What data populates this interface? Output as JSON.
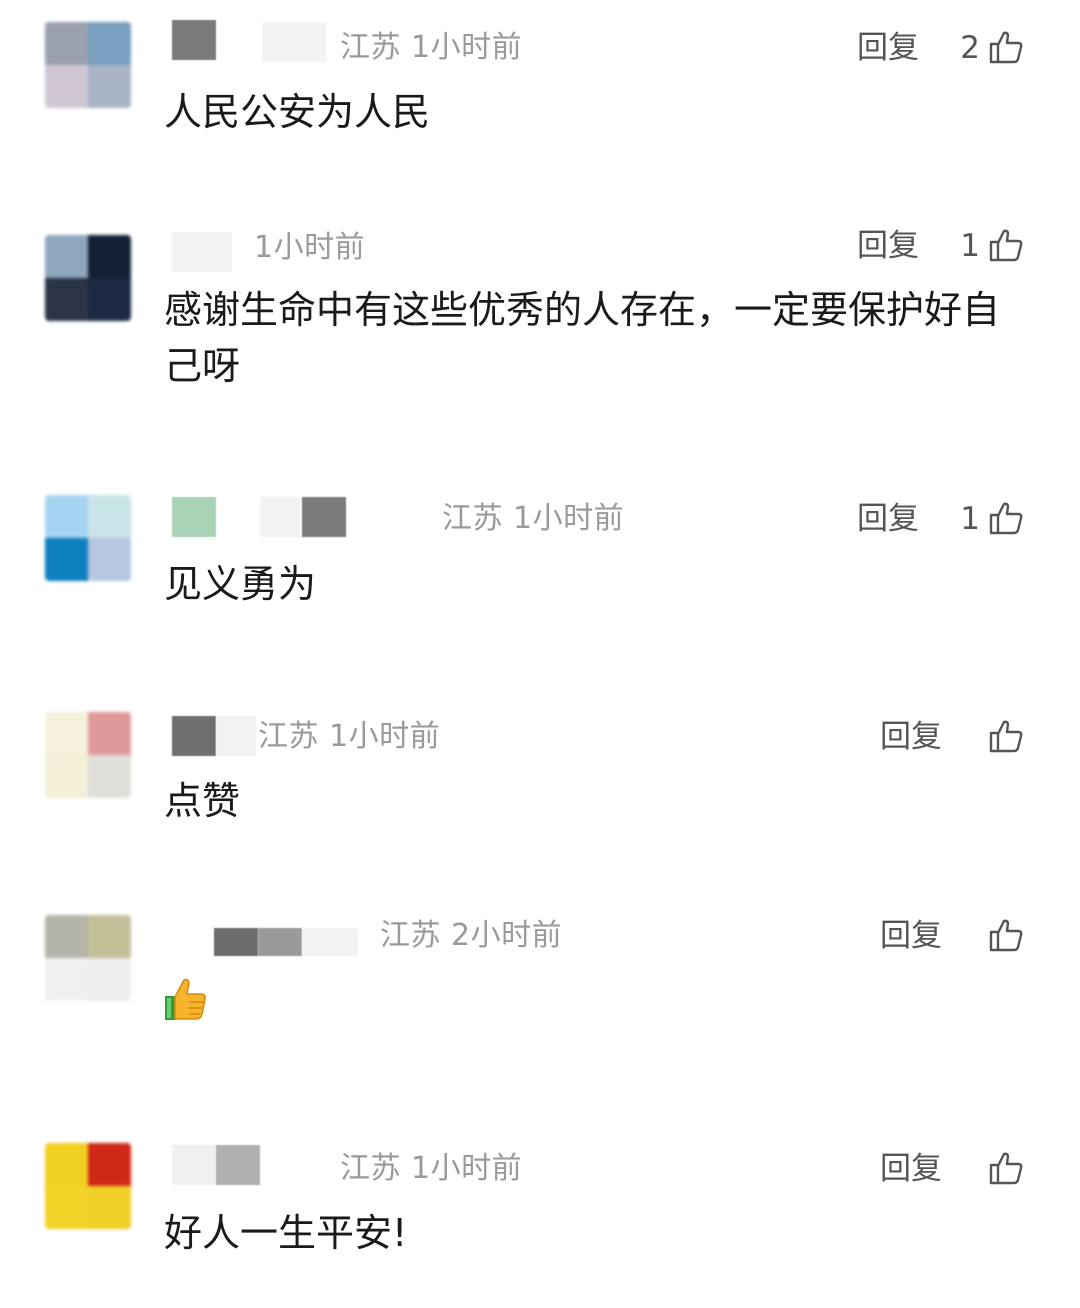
{
  "comments": [
    {
      "location": "江苏",
      "time": "1小时前",
      "reply_label": "回复",
      "likes": "2",
      "text": "人民公安为人民",
      "avatar_colors": [
        "#9aa0b0",
        "#7a9fbf",
        "#cfc6d2",
        "#a9b4c7"
      ]
    },
    {
      "location": "",
      "time": "1小时前",
      "reply_label": "回复",
      "likes": "1",
      "text": "感谢生命中有这些优秀的人存在，一定要保护好自己呀",
      "avatar_colors": [
        "#8ea7bd",
        "#132035",
        "#2a3444",
        "#1c2a44"
      ]
    },
    {
      "location": "江苏",
      "time": "1小时前",
      "reply_label": "回复",
      "likes": "1",
      "text": "见义勇为",
      "avatar_colors": [
        "#a6d4f0",
        "#c9e4e8",
        "#0e7fbf",
        "#b7c7e0"
      ]
    },
    {
      "location": "江苏",
      "time": "1小时前",
      "reply_label": "回复",
      "likes": "",
      "text": "点赞",
      "avatar_colors": [
        "#f6f1dc",
        "#e0999a",
        "#f3efd8",
        "#dfe0dc"
      ]
    },
    {
      "location": "江苏",
      "time": "2小时前",
      "reply_label": "回复",
      "likes": "",
      "text": "",
      "emoji": "thumbs-up",
      "avatar_colors": [
        "#b4b4a8",
        "#c4c09a",
        "#f0f0ee",
        "#eeeeec"
      ]
    },
    {
      "location": "江苏",
      "time": "1小时前",
      "reply_label": "回复",
      "likes": "",
      "text": "好人一生平安!",
      "avatar_colors": [
        "#f0d020",
        "#d02818",
        "#f2d428",
        "#f0cf26"
      ]
    }
  ],
  "colors": {
    "meta": "#9a9a9a",
    "reply": "#555555",
    "text": "#1a1a1a"
  }
}
